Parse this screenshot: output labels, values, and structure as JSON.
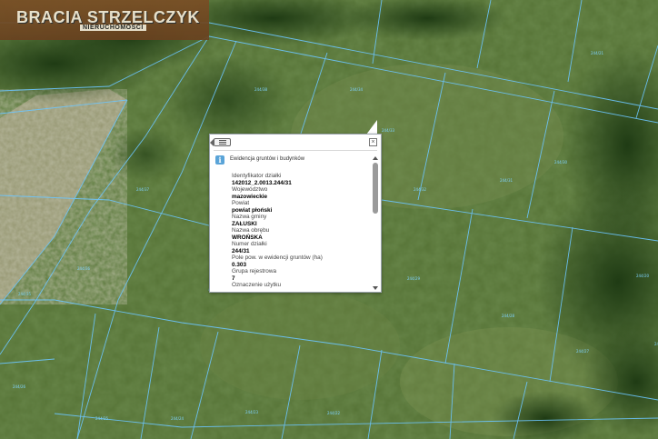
{
  "logo": {
    "main": "BRACIA STRZELCZYK",
    "sub": "NIERUCHOMOŚCI"
  },
  "popup": {
    "layer_title": "Ewidencja gruntów i budynków",
    "rows": [
      {
        "label": "Identyfikator działki",
        "value": "142012_2.0013.244/31"
      },
      {
        "label": "Województwo",
        "value": "mazowieckie"
      },
      {
        "label": "Powiat",
        "value": "powiat płoński"
      },
      {
        "label": "Nazwa gminy",
        "value": "ZAŁUSKI"
      },
      {
        "label": "Nazwa obrębu",
        "value": "WROŃSKA"
      },
      {
        "label": "Numer działki",
        "value": "244/31"
      },
      {
        "label": "Pole pow. w ewidencji gruntów (ha)",
        "value": "0.303"
      },
      {
        "label": "Grupa rejestrowa",
        "value": "7"
      },
      {
        "label": "Oznaczenie użytku",
        "value": ""
      }
    ],
    "icons": {
      "back": "list-back-icon",
      "close": "close-icon",
      "info": "info-icon"
    }
  },
  "colors": {
    "parcel_lines": "#6cc6ff",
    "logo_bg": "#6f4622",
    "popup_bg": "#ffffff",
    "info_icon": "#5aa4d8"
  },
  "parcel_labels": [
    "244/38",
    "244/37",
    "244/36",
    "244/35",
    "244/34",
    "244/33",
    "244/32",
    "244/31",
    "244/30",
    "244/29",
    "244/28",
    "244/27",
    "244/26",
    "244/25",
    "244/24",
    "244/23",
    "244/22",
    "244/21",
    "244/20",
    "244/19"
  ]
}
